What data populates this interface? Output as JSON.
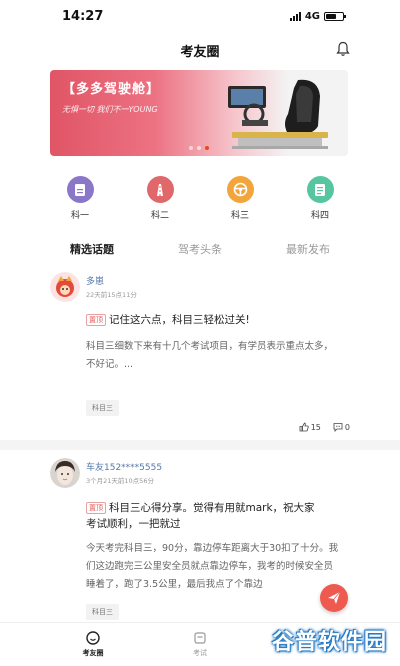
{
  "status": {
    "time": "14:27",
    "network": "4G"
  },
  "header": {
    "title": "考友圈"
  },
  "banner": {
    "title": "【多多驾驶舱】",
    "subtitle": "无惧一切 我们不一YOUNG"
  },
  "subjects": [
    {
      "label": "科一",
      "color": "#8a77c9"
    },
    {
      "label": "科二",
      "color": "#e0686a"
    },
    {
      "label": "科三",
      "color": "#f2a53a"
    },
    {
      "label": "科四",
      "color": "#56c6a0"
    }
  ],
  "tabs": [
    {
      "label": "精选话题",
      "active": true
    },
    {
      "label": "驾考头条",
      "active": false
    },
    {
      "label": "最新发布",
      "active": false
    }
  ],
  "posts": [
    {
      "author": "多崽",
      "time": "22天前15点11分",
      "pin": "置顶",
      "title": "记住这六点，科目三轻松过关!",
      "body": "科目三细数下来有十几个考试项目，有学员表示重点太多，不好记。...",
      "tag": "科目三",
      "likes": "15",
      "comments": "0"
    },
    {
      "author": "车友152****5555",
      "time": "3个月21天前10点56分",
      "pin": "置顶",
      "title_line1": "科目三心得分享。觉得有用就mark，祝大家",
      "title_line2": "考试顺利，一把就过",
      "body": "今天考完科目三，90分，靠边停车距离大于30扣了十分。我们这边跑完三公里安全员就点靠边停车，我考的时候安全员睡着了，跑了3.5公里，最后我点了个靠边",
      "tag": "科目三"
    }
  ],
  "tabbar": [
    {
      "label": "考友圈",
      "active": true
    },
    {
      "label": "考试",
      "active": false
    }
  ],
  "watermark": "谷普软件园"
}
